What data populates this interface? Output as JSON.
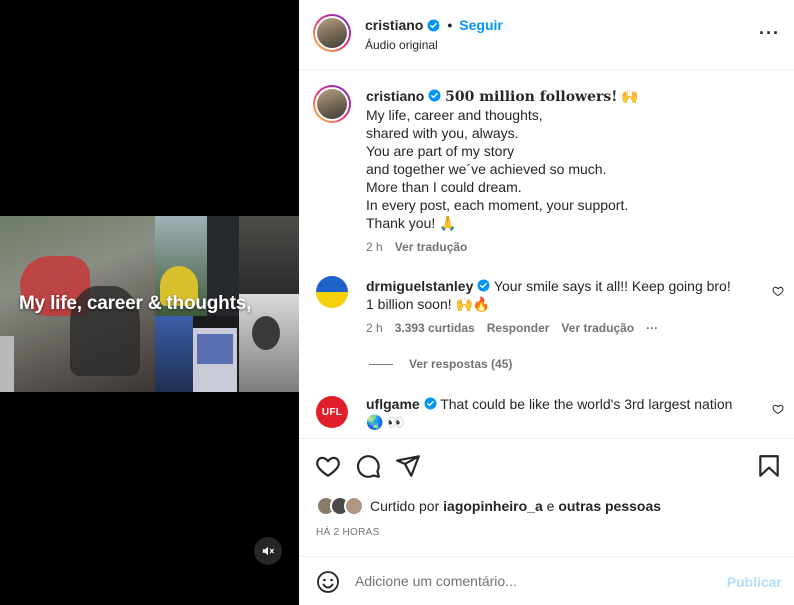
{
  "media": {
    "overlay_text": "My life, career & thoughts,"
  },
  "header": {
    "username": "cristiano",
    "separator": "•",
    "follow_label": "Seguir",
    "audio_label": "Áudio original",
    "more_label": "···"
  },
  "caption": {
    "username": "cristiano",
    "headline": "500 million followers!",
    "headline_emoji": "🙌",
    "lines": [
      "My life, career and thoughts,",
      "shared with you, always.",
      "You are part of my story",
      "and together we´ve achieved so much.",
      "More than I could dream.",
      "In every post, each moment, your support.",
      "Thank you! 🙏"
    ],
    "time": "2 h",
    "translate_label": "Ver tradução"
  },
  "comments": [
    {
      "username": "drmiguelstanley",
      "text": "Your smile says it all!! Keep going bro! 1 billion soon! 🙌🔥",
      "time": "2 h",
      "likes": "3.393 curtidas",
      "reply_label": "Responder",
      "translate_label": "Ver tradução",
      "more_label": "···"
    },
    {
      "username": "uflgame",
      "avatar_text": "UFL",
      "text": "That could be like the world's 3rd largest nation 🌏 👀"
    }
  ],
  "replies": {
    "label": "Ver respostas (45)"
  },
  "actions": {
    "liked_by_prefix": "Curtido por",
    "liked_by_user": "iagopinheiro_a",
    "liked_by_joiner": "e",
    "liked_by_others": "outras pessoas",
    "timestamp": "HÁ 2 HORAS"
  },
  "composer": {
    "placeholder": "Adicione um comentário...",
    "post_label": "Publicar"
  },
  "colors": {
    "accent": "#0095f6",
    "muted": "#737373",
    "post_disabled": "#b2dffc"
  }
}
